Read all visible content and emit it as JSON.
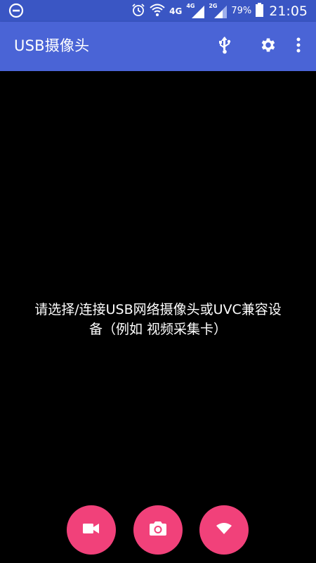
{
  "status_bar": {
    "net_label_1": "4G",
    "net_label_2": "4G",
    "net_label_3": "2G",
    "battery_percent": "79%",
    "time": "21:05",
    "icons": [
      "dnd-icon",
      "alarm-icon",
      "wifi-icon",
      "signal-icon",
      "signal-icon",
      "battery-icon"
    ]
  },
  "app_bar": {
    "title": "USB摄像头",
    "actions": [
      "usb-icon",
      "settings-icon",
      "overflow-menu-icon"
    ]
  },
  "preview": {
    "message_line1": "请选择/连接USB网络摄像头或UVC兼容设",
    "message_line2": "备（例如 视频采集卡）"
  },
  "fabs": [
    {
      "icon": "video-camera-icon"
    },
    {
      "icon": "camera-icon"
    },
    {
      "icon": "wifi-icon"
    }
  ],
  "colors": {
    "app_bar": "#4a64d6",
    "status_bar": "#3a56c4",
    "fab": "#f1417a",
    "background": "#000000"
  }
}
